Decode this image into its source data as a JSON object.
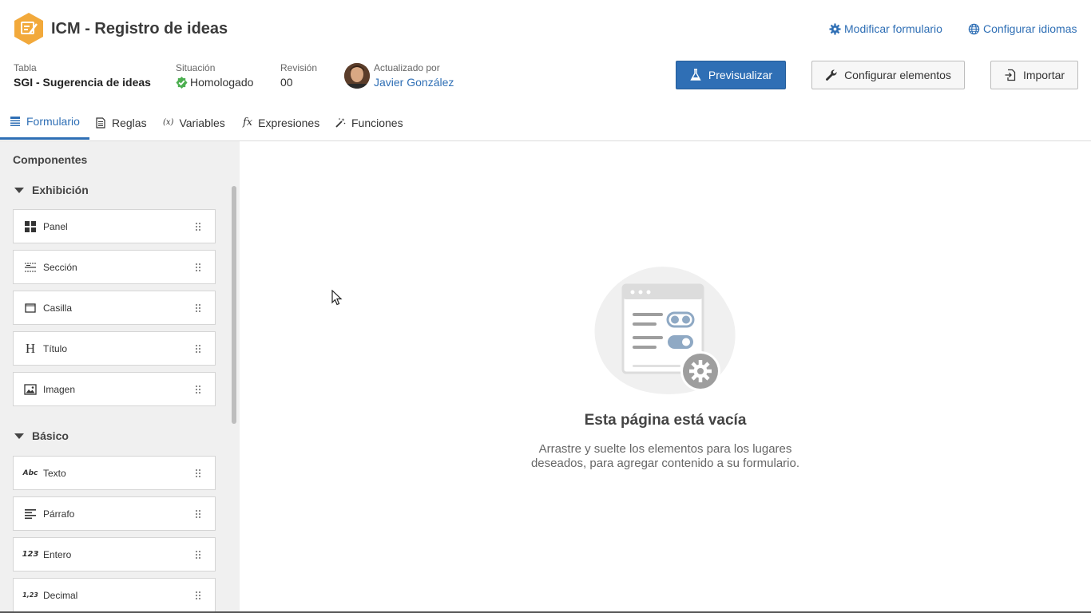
{
  "header": {
    "title": "ICM - Registro de ideas",
    "logo_color": "#f2a93b",
    "links": [
      {
        "label": "Modificar formulario",
        "icon": "gear-icon"
      },
      {
        "label": "Configurar idiomas",
        "icon": "globe-icon"
      }
    ]
  },
  "info": {
    "table_label": "Tabla",
    "table_value": "SGI - Sugerencia de ideas",
    "status_label": "Situación",
    "status_value": "Homologado",
    "status_color": "#4caf50",
    "revision_label": "Revisión",
    "revision_value": "00",
    "updated_label": "Actualizado por",
    "updated_value": "Javier González"
  },
  "buttons": {
    "preview": "Previsualizar",
    "configure": "Configurar elementos",
    "import": "Importar"
  },
  "tabs": [
    {
      "label": "Formulario",
      "icon": "form-icon",
      "active": true
    },
    {
      "label": "Reglas",
      "icon": "rules-icon",
      "active": false
    },
    {
      "label": "Variables",
      "icon": "variables-icon",
      "active": false
    },
    {
      "label": "Expresiones",
      "icon": "function-icon",
      "active": false
    },
    {
      "label": "Funciones",
      "icon": "magic-wand-icon",
      "active": false
    }
  ],
  "sidebar": {
    "title": "Componentes",
    "groups": [
      {
        "label": "Exhibición",
        "items": [
          {
            "label": "Panel",
            "icon": "panel-icon"
          },
          {
            "label": "Sección",
            "icon": "section-icon"
          },
          {
            "label": "Casilla",
            "icon": "box-icon"
          },
          {
            "label": "Título",
            "icon": "heading-icon",
            "glyph": "H"
          },
          {
            "label": "Imagen",
            "icon": "image-icon"
          }
        ]
      },
      {
        "label": "Básico",
        "items": [
          {
            "label": "Texto",
            "icon": "text-icon",
            "glyph": "Abc"
          },
          {
            "label": "Párrafo",
            "icon": "paragraph-icon"
          },
          {
            "label": "Entero",
            "icon": "integer-icon",
            "glyph": "123"
          },
          {
            "label": "Decimal",
            "icon": "decimal-icon",
            "glyph": "1,23"
          }
        ]
      }
    ]
  },
  "main": {
    "empty_title": "Esta página está vacía",
    "empty_desc_line1": "Arrastre y suelte los elementos para los lugares",
    "empty_desc_line2": "deseados, para agregar contenido a su formulario."
  },
  "colors": {
    "accent": "#2f6fb5",
    "sidebar_bg": "#f0f0f0"
  }
}
